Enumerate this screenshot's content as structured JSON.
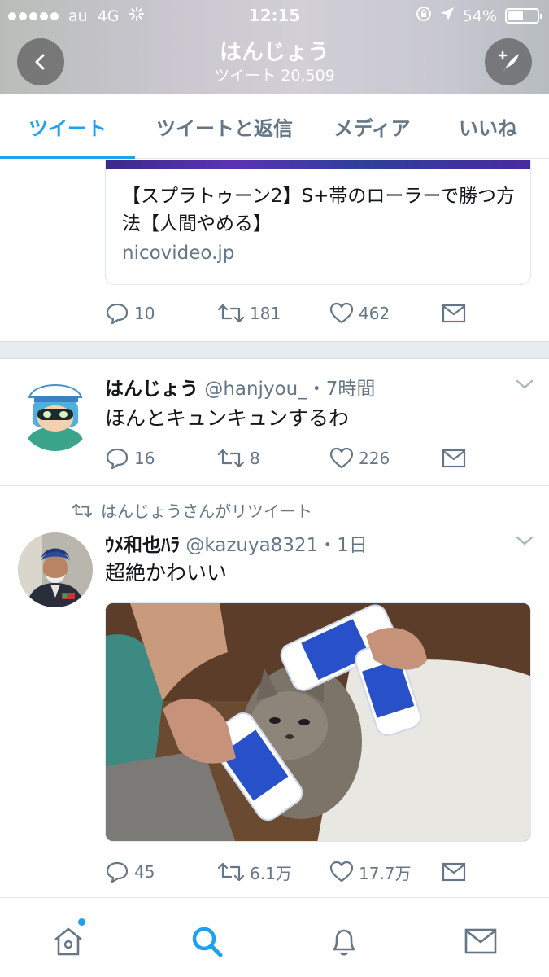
{
  "status_bar": {
    "carrier": "au",
    "network": "4G",
    "time": "12:15",
    "battery_percent": "54%",
    "battery_level": 0.54
  },
  "header": {
    "title": "はんじょう",
    "tweet_count": "ツイート 20,509"
  },
  "tabs": [
    {
      "label": "ツイート",
      "active": true
    },
    {
      "label": "ツイートと返信",
      "active": false
    },
    {
      "label": "メディア",
      "active": false
    },
    {
      "label": "いいね",
      "active": false
    }
  ],
  "link_card": {
    "title": "【スプラトゥーン2】S+帯のローラーで勝つ方法【人間やめる】",
    "domain": "nicovideo.jp",
    "replies": "10",
    "retweets": "181",
    "likes": "462"
  },
  "tweet1": {
    "name": "はんじょう",
    "handle_time": "@hanjyou_・7時間",
    "text": "ほんとキュンキュンするわ",
    "replies": "16",
    "retweets": "8",
    "likes": "226"
  },
  "tweet2": {
    "retweet_notice": "はんじょうさんがリツイート",
    "name": "ｳﾒ和也ﾊﾗ",
    "handle_time": "@kazuya8321・1日",
    "text": "超絶かわいい",
    "replies": "45",
    "retweets": "6.1万",
    "likes": "17.7万"
  },
  "colors": {
    "accent": "#1da1f2",
    "muted": "#657786"
  }
}
